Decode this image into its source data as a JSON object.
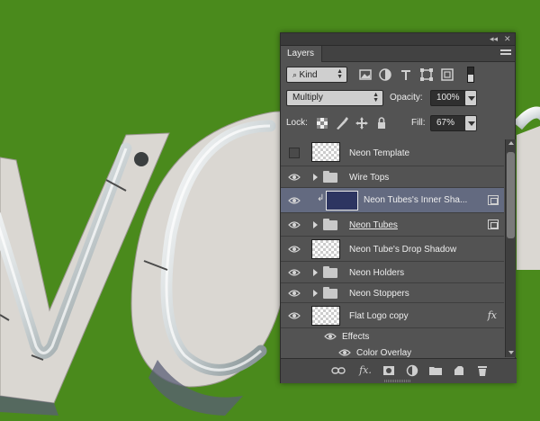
{
  "panel": {
    "tab_label": "Layers",
    "collapse_label": "◂◂",
    "close_label": "✕",
    "filter": {
      "kind_label": "Kind"
    },
    "blend_mode": "Multiply",
    "opacity_label": "Opacity:",
    "opacity_value": "100%",
    "lock_label": "Lock:",
    "fill_label": "Fill:",
    "fill_value": "67%"
  },
  "layers": [
    {
      "name": "Neon Template",
      "type": "layer",
      "visible": false
    },
    {
      "name": "Wire Tops",
      "type": "group",
      "visible": true
    },
    {
      "name": "Neon Tubes's Inner Sha...",
      "type": "clipped-smart",
      "visible": true,
      "selected": true
    },
    {
      "name": "Neon Tubes",
      "type": "group-smart",
      "visible": true
    },
    {
      "name": "Neon Tube's Drop Shadow",
      "type": "layer",
      "visible": true
    },
    {
      "name": "Neon Holders",
      "type": "group",
      "visible": true
    },
    {
      "name": "Neon Stoppers",
      "type": "group",
      "visible": true
    },
    {
      "name": "Flat Logo copy",
      "type": "layer-fx",
      "visible": true,
      "fx_label": "fx"
    },
    {
      "name": "Effects",
      "type": "effects",
      "visible": true
    },
    {
      "name": "Color Overlay",
      "type": "effect",
      "visible": true
    }
  ],
  "footer": {
    "link_icon": "link-icon",
    "fx_label": "fx.",
    "mask_icon": "mask-icon",
    "adjust_icon": "adjustment-icon",
    "folder_icon": "new-group-icon",
    "new_layer_icon": "new-layer-icon",
    "trash_icon": "trash-icon"
  },
  "colors": {
    "background": "#4a8a1c",
    "panel": "#535353",
    "selected": "#636a80"
  }
}
